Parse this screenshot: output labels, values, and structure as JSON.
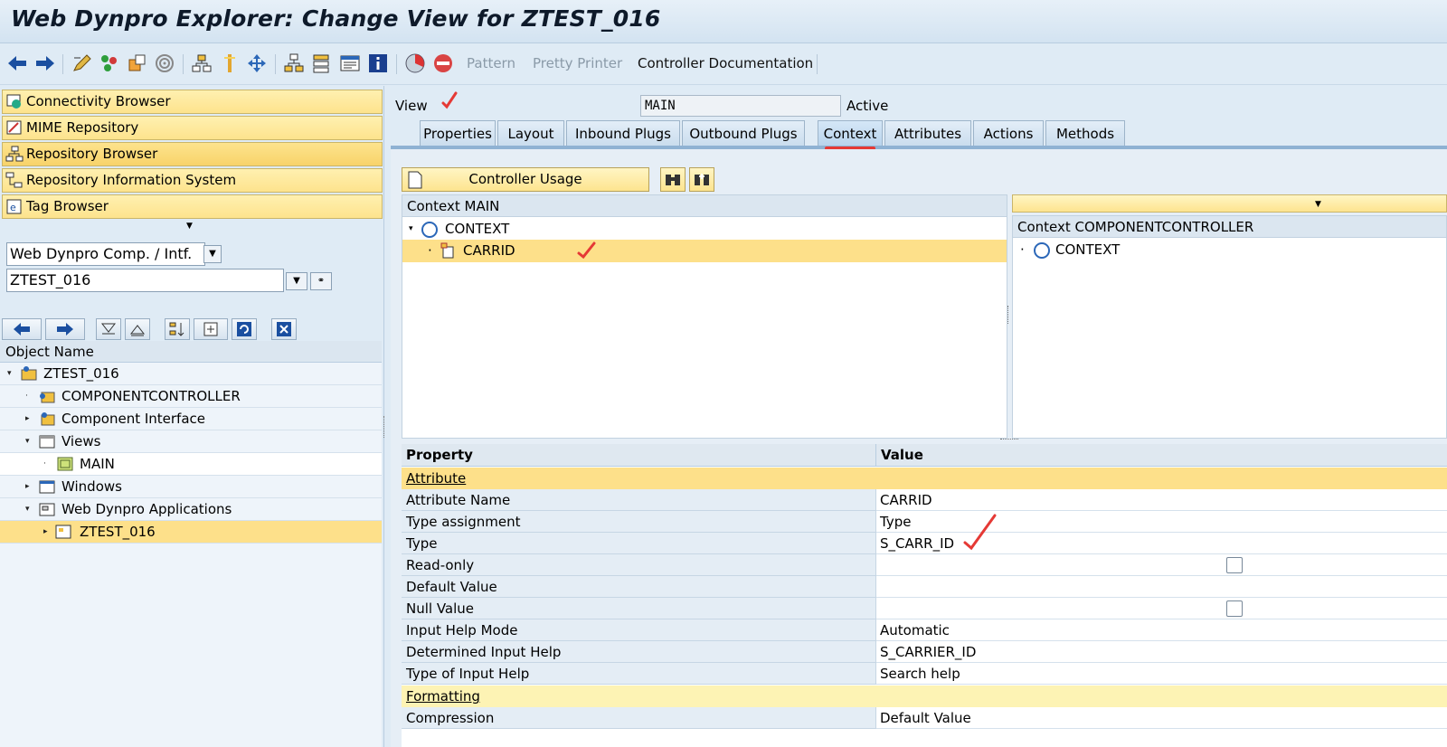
{
  "window": {
    "title": "Web Dynpro Explorer: Change View for ZTEST_016"
  },
  "toolbar": {
    "icons": [
      "back-icon",
      "forward-icon",
      "edit-icon",
      "activate-icon",
      "other-object-icon",
      "where-used-icon",
      "hierarchy-icon",
      "display-object-list-icon",
      "navigator-icon",
      "layout-icon",
      "node-icon",
      "window-icon",
      "info-icon",
      "test-icon",
      "stop-icon"
    ],
    "pattern_label": "Pattern",
    "pretty_printer_label": "Pretty Printer",
    "controller_doc_label": "Controller Documentation"
  },
  "nav": {
    "items": [
      {
        "label": "Connectivity Browser"
      },
      {
        "label": "MIME Repository"
      },
      {
        "label": "Repository Browser"
      },
      {
        "label": "Repository Information System"
      },
      {
        "label": "Tag Browser"
      }
    ],
    "object_type_select": "Web Dynpro Comp. / Intf.",
    "object_name_input": "ZTEST_016"
  },
  "object_tree": {
    "header": "Object Name",
    "rows": [
      {
        "label": "ZTEST_016"
      },
      {
        "label": "COMPONENTCONTROLLER"
      },
      {
        "label": "Component Interface"
      },
      {
        "label": "Views"
      },
      {
        "label": "MAIN"
      },
      {
        "label": "Windows"
      },
      {
        "label": "Web Dynpro Applications"
      },
      {
        "label": "ZTEST_016"
      }
    ]
  },
  "view_header": {
    "view_label": "View",
    "view_value": "MAIN",
    "status": "Active"
  },
  "tabs": [
    {
      "label": "Properties"
    },
    {
      "label": "Layout"
    },
    {
      "label": "Inbound Plugs"
    },
    {
      "label": "Outbound Plugs"
    },
    {
      "label": "Context"
    },
    {
      "label": "Attributes"
    },
    {
      "label": "Actions"
    },
    {
      "label": "Methods"
    }
  ],
  "context": {
    "controller_usage_label": "Controller Usage",
    "left_title": "Context MAIN",
    "left_nodes": [
      {
        "label": "CONTEXT"
      },
      {
        "label": "CARRID"
      }
    ],
    "right_title": "Context COMPONENTCONTROLLER",
    "right_nodes": [
      {
        "label": "CONTEXT"
      }
    ]
  },
  "properties": {
    "header_property": "Property",
    "header_value": "Value",
    "rows": [
      {
        "property": "Attribute",
        "value": "",
        "kind": "group"
      },
      {
        "property": "Attribute Name",
        "value": "CARRID"
      },
      {
        "property": "Type assignment",
        "value": "Type"
      },
      {
        "property": "Type",
        "value": "S_CARR_ID"
      },
      {
        "property": "Read-only",
        "value": "",
        "checkbox": false
      },
      {
        "property": "Default Value",
        "value": ""
      },
      {
        "property": "Null Value",
        "value": "",
        "checkbox": false
      },
      {
        "property": "Input Help Mode",
        "value": "Automatic"
      },
      {
        "property": "Determined Input Help",
        "value": "S_CARRIER_ID"
      },
      {
        "property": "Type of Input Help",
        "value": "Search help"
      },
      {
        "property": "Formatting",
        "value": "",
        "kind": "group"
      },
      {
        "property": "Compression",
        "value": "Default Value"
      }
    ]
  },
  "colors": {
    "accent": "#fde08a",
    "tab_underline": "#e53935",
    "annotation_red": "#e53935"
  }
}
